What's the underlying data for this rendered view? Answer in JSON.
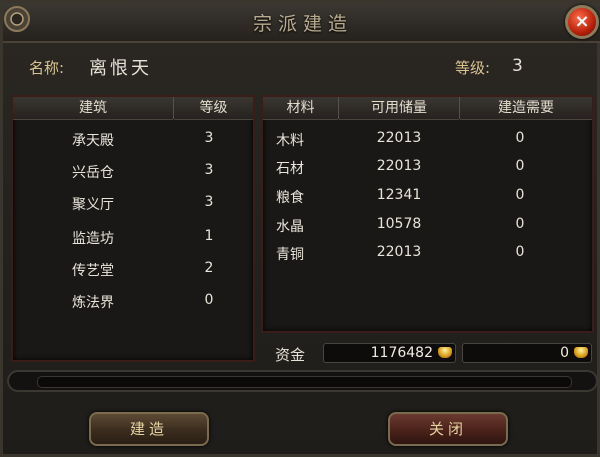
{
  "window": {
    "title": "宗派建造",
    "close_icon": "×"
  },
  "sect": {
    "name_label": "名称:",
    "name": "离恨天",
    "level_label": "等级:",
    "level": "3"
  },
  "buildings": {
    "headers": [
      "建筑",
      "等级"
    ],
    "rows": [
      {
        "name": "承天殿",
        "level": "3"
      },
      {
        "name": "兴岳仓",
        "level": "3"
      },
      {
        "name": "聚义厅",
        "level": "3"
      },
      {
        "name": "监造坊",
        "level": "1"
      },
      {
        "name": "传艺堂",
        "level": "2"
      },
      {
        "name": "炼法界",
        "level": "0"
      }
    ]
  },
  "materials": {
    "headers": [
      "材料",
      "可用储量",
      "建造需要"
    ],
    "rows": [
      {
        "name": "木料",
        "stock": "22013",
        "need": "0"
      },
      {
        "name": "石材",
        "stock": "22013",
        "need": "0"
      },
      {
        "name": "粮食",
        "stock": "12341",
        "need": "0"
      },
      {
        "name": "水晶",
        "stock": "10578",
        "need": "0"
      },
      {
        "name": "青铜",
        "stock": "22013",
        "need": "0"
      }
    ]
  },
  "funds": {
    "label": "资金",
    "available": "1176482",
    "required": "0"
  },
  "buttons": {
    "build": "建造",
    "close": "关闭"
  },
  "colors": {
    "accent_gold": "#d9c291",
    "panel_border": "#3a1d18",
    "close_red": "#b8200a"
  }
}
